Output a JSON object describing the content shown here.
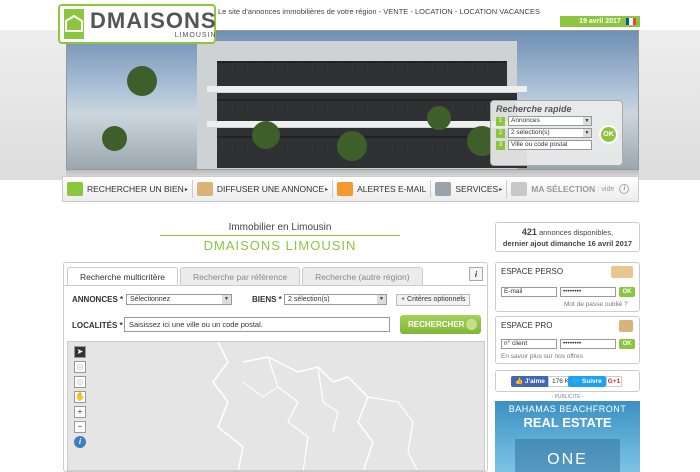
{
  "header": {
    "logo_main": "DMAISONS",
    "logo_sub": "LIMOUSIN",
    "tagline": "Le site d'annonces immobilières de votre région",
    "tagline_links": " - VENTE - LOCATION - LOCATION VACANCES",
    "date": "19 avril 2017"
  },
  "quick_search": {
    "title": "Recherche rapide",
    "rows": [
      {
        "num": "1",
        "value": "Annonces"
      },
      {
        "num": "2",
        "value": "2 sélection(s)"
      },
      {
        "num": "3",
        "value": "Ville ou code postal"
      }
    ],
    "ok": "OK"
  },
  "nav": {
    "items": [
      {
        "label": "RECHERCHER UN BIEN",
        "arrow": "▸"
      },
      {
        "label": "DIFFUSER UNE ANNONCE",
        "arrow": "▸"
      },
      {
        "label": "ALERTES E-MAIL",
        "arrow": "▸"
      },
      {
        "label": "SERVICES",
        "arrow": "▸"
      }
    ],
    "selection_label": "MA SÉLECTION",
    "selection_value": ": vide"
  },
  "title": {
    "h1": "Immobilier en Limousin",
    "h2": "DMAISONS LIMOUSIN"
  },
  "stats": {
    "count": "421",
    "count_text": " annonces disponibles,",
    "last": "dernier ajout dimanche 16 avril 2017"
  },
  "search": {
    "tabs": [
      "Recherche multicritère",
      "Recherche par référence",
      "Recherche (autre région)"
    ],
    "info": "i",
    "annonces_label": "ANNONCES",
    "annonces_value": "Sélectionnez",
    "biens_label": "BIENS",
    "biens_value": "2 sélection(s)",
    "criteres": "Critères optionnels",
    "localites_label": "LOCALITÉS",
    "localites_placeholder": "Saisissez ici une ville ou un code postal.",
    "button": "RECHERCHER"
  },
  "espace_perso": {
    "title": "ESPACE PERSO",
    "email_placeholder": "E-mail",
    "password": "••••••••",
    "ok": "OK",
    "forgot": "Mot de passe oublié ?"
  },
  "espace_pro": {
    "title": "ESPACE PRO",
    "client_placeholder": "n° client",
    "password": "••••••••",
    "ok": "OK",
    "more": "En savoir plus sur nos offres"
  },
  "social": {
    "fb_label": "J'aime",
    "fb_count": "176 K",
    "tw_label": "Suivre",
    "gp_label": "G+1"
  },
  "ad": {
    "label": "- PUBLICITÉ -",
    "line1": "BAHAMAS BEACHFRONT",
    "line2": "REAL ESTATE",
    "line3": "ONE"
  },
  "colors": {
    "accent": "#8cc63f"
  }
}
